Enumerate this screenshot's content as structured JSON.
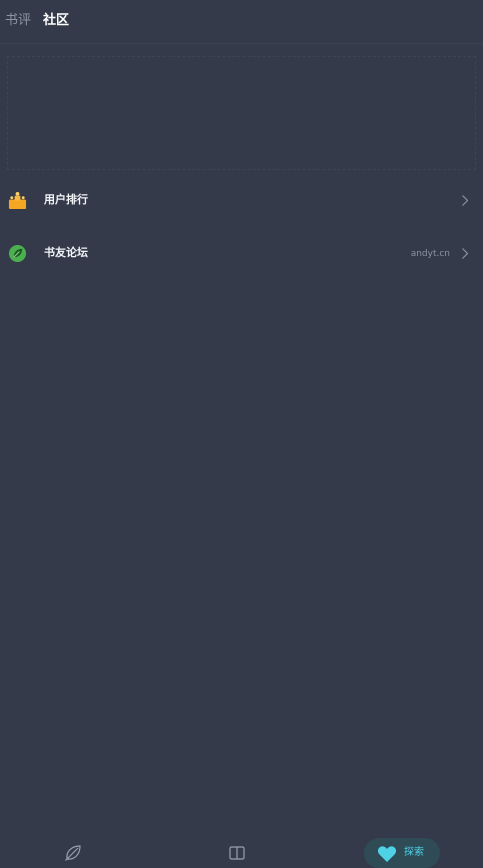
{
  "header": {
    "tabs": [
      {
        "label": "书评"
      },
      {
        "label": "社区"
      }
    ]
  },
  "list": {
    "items": [
      {
        "label": "用户排行",
        "icon": "podium-icon",
        "note": ""
      },
      {
        "label": "书友论坛",
        "icon": "forum-leaf-icon",
        "note": "andyt.cn"
      }
    ]
  },
  "bottom_nav": {
    "items": [
      {
        "icon": "leaf-discover-icon"
      },
      {
        "icon": "book-shelf-icon"
      },
      {
        "icon": "heart-icon",
        "label": "探索"
      }
    ]
  },
  "colors": {
    "background": "#343a49",
    "accent": "#4fd2e6",
    "active_pill": "#2f4b56"
  }
}
